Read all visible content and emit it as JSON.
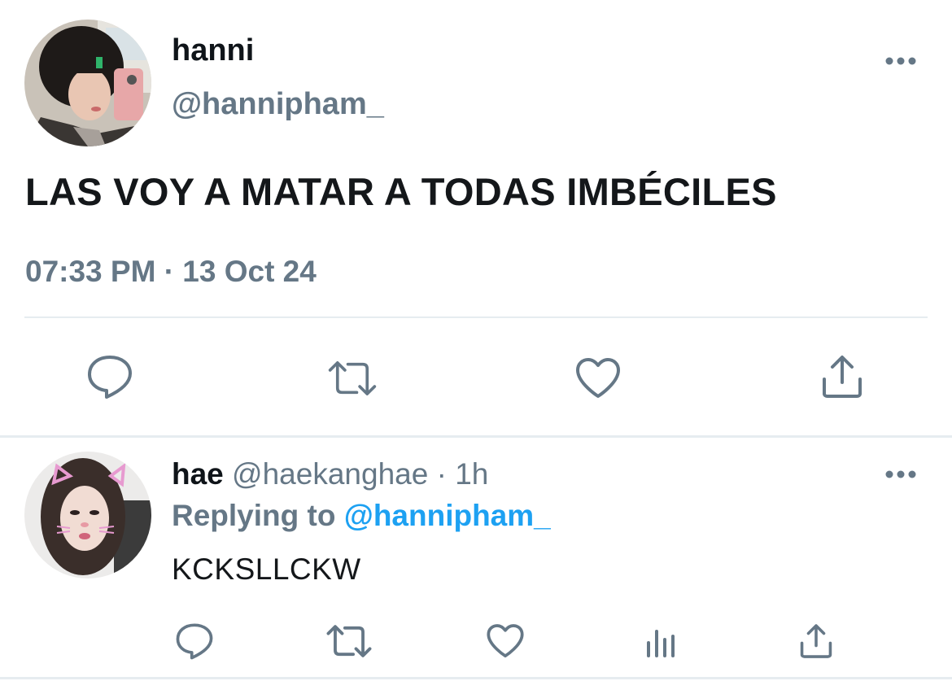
{
  "tweet": {
    "display_name": "hanni",
    "handle": "@hannipham_",
    "text": "LAS VOY A MATAR A TODAS IMBÉCILES",
    "timestamp": "07:33 PM · 13 Oct 24"
  },
  "reply": {
    "display_name": "hae",
    "handle": "@haekanghae",
    "separator": "·",
    "time_ago": "1h",
    "replying_label": "Replying to",
    "replying_handle": "@hannipham_",
    "text": "KCKSLLCKW"
  },
  "icons": {
    "more": "more-horizontal-icon",
    "reply": "comment-bubble-icon",
    "retweet": "retweet-icon",
    "like": "heart-icon",
    "share": "share-upload-icon",
    "analytics": "analytics-bars-icon"
  },
  "colors": {
    "text_primary": "#0f1419",
    "text_secondary": "#657786",
    "link_blue": "#1da1f2",
    "divider": "#e6ecf0"
  }
}
